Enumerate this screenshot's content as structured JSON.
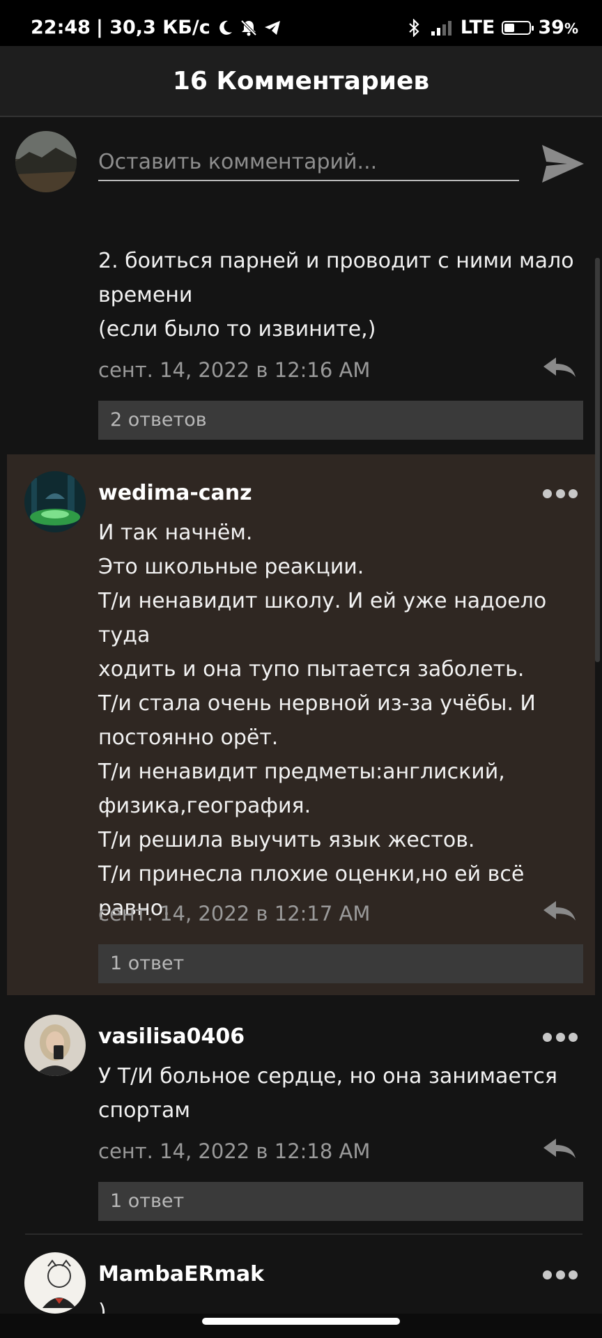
{
  "status_bar": {
    "time": "22:48",
    "net_speed": "| 30,3 КБ/с",
    "network": "LTE",
    "battery": "39",
    "battery_unit": "%",
    "battery_level": 0.39
  },
  "header": {
    "title": "16 Комментариев"
  },
  "compose": {
    "placeholder": "Оставить комментарий..."
  },
  "comments": [
    {
      "text": "2. боиться парней и проводит с ними мало\nвремени\n(если было то извините,)",
      "timestamp": "сент. 14, 2022 в 12:16 AM",
      "replies": "2 ответов"
    },
    {
      "username": "wedima-canz",
      "text": "И так начнём.\nЭто школьные реакции.\nТ/и ненавидит школу. И ей уже надоело туда\nходить и она тупо пытается заболеть.\nТ/и стала очень нервной из-за учёбы. И\nпостоянно орёт.\nТ/и ненавидит предметы:англиский,\nфизика,география.\nТ/и решила выучить язык жестов.\nТ/и  принесла плохие оценки,но ей всё\nравно.",
      "timestamp": "сент. 14, 2022 в 12:17 AM",
      "replies": "1 ответ"
    },
    {
      "username": "vasilisa0406",
      "text": "У Т/И больное сердце, но она занимается\nспортам",
      "timestamp": "сент. 14, 2022 в 12:18 AM",
      "replies": "1 ответ"
    },
    {
      "username": "MambaERmak",
      "text": ")"
    }
  ]
}
